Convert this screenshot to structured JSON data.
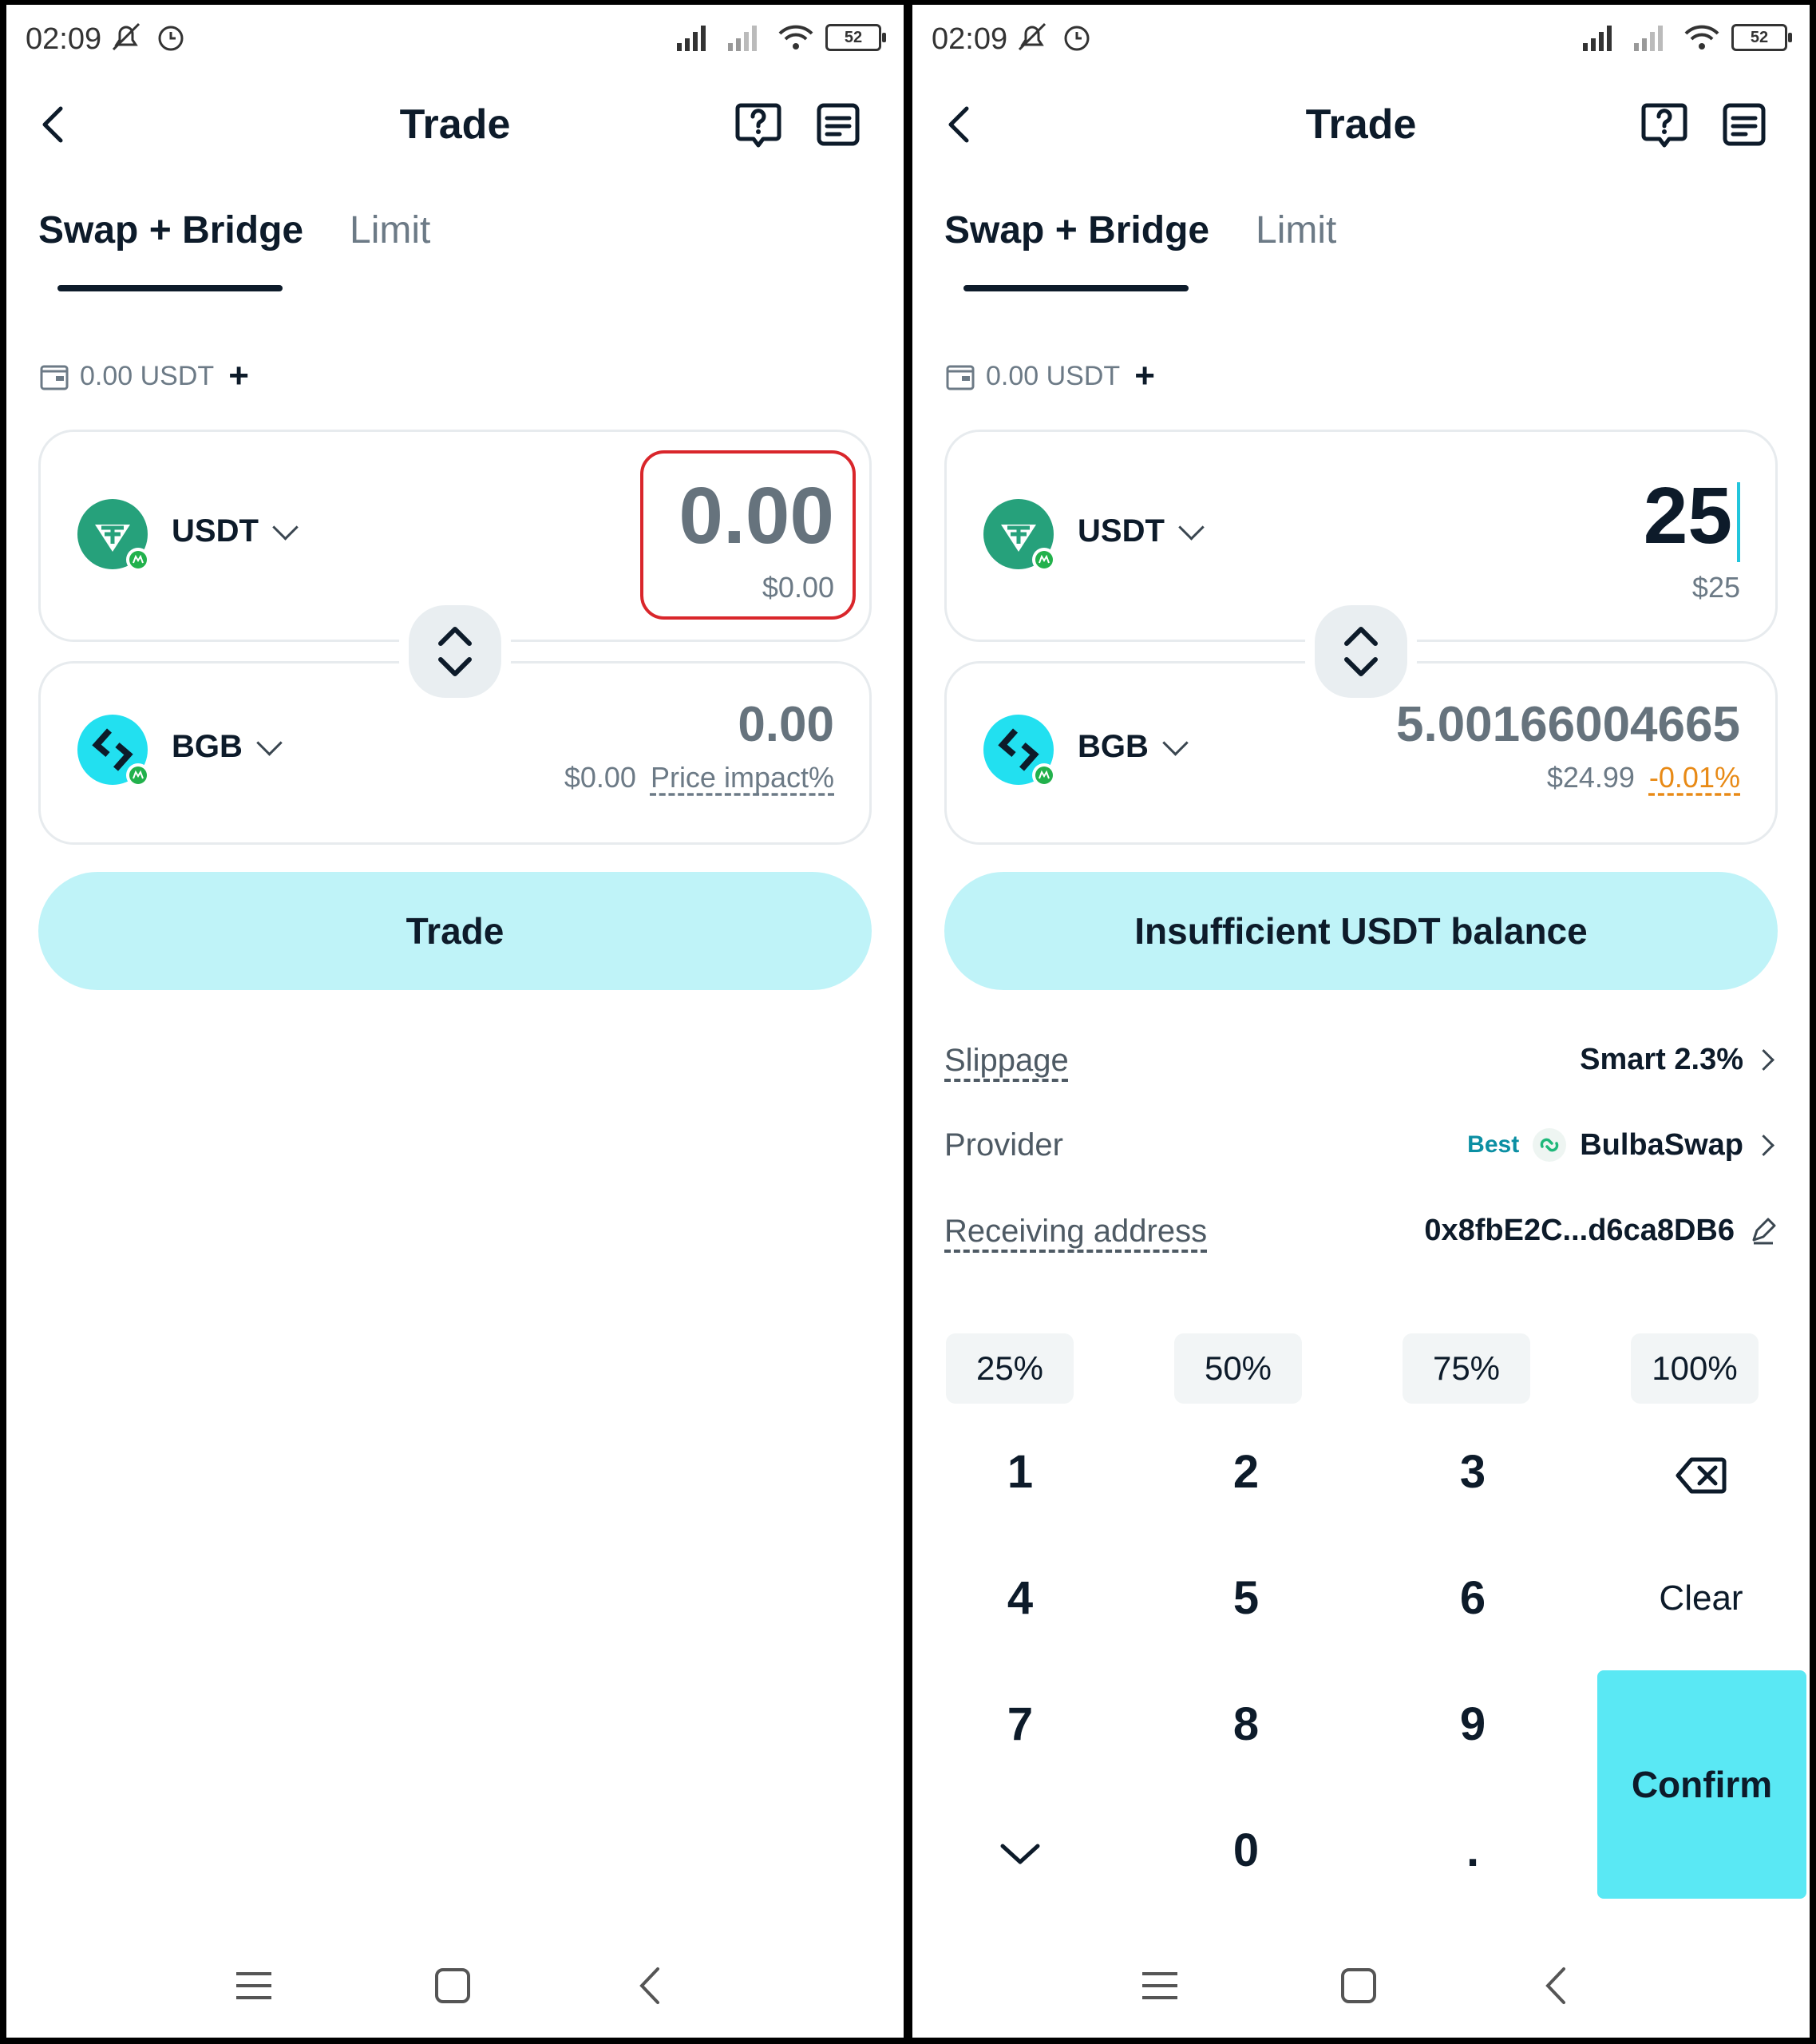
{
  "screens": {
    "left": {
      "status": {
        "time": "02:09",
        "battery": "52"
      },
      "header": {
        "title": "Trade"
      },
      "tabs": {
        "swap": "Swap + Bridge",
        "limit": "Limit"
      },
      "balance": "0.00 USDT",
      "from": {
        "token": "USDT",
        "amount": "0.00",
        "usd": "$0.00"
      },
      "to": {
        "token": "BGB",
        "amount": "0.00",
        "usd": "$0.00",
        "impact": "Price impact%"
      },
      "button": "Trade"
    },
    "right": {
      "status": {
        "time": "02:09",
        "battery": "52"
      },
      "header": {
        "title": "Trade"
      },
      "tabs": {
        "swap": "Swap + Bridge",
        "limit": "Limit"
      },
      "balance": "0.00 USDT",
      "from": {
        "token": "USDT",
        "amount": "25",
        "usd": "$25"
      },
      "to": {
        "token": "BGB",
        "amount": "5.00166004665",
        "usd": "$24.99",
        "impact": "-0.01%"
      },
      "button": "Insufficient USDT balance",
      "details": {
        "slippage_label": "Slippage",
        "slippage_value": "Smart 2.3%",
        "provider_label": "Provider",
        "provider_badge": "Best",
        "provider_value": "BulbaSwap",
        "address_label": "Receiving address",
        "address_value": "0x8fbE2C...d6ca8DB6"
      },
      "keypad": {
        "percentages": [
          "25%",
          "50%",
          "75%",
          "100%"
        ],
        "keys": [
          "1",
          "2",
          "3",
          "4",
          "5",
          "6",
          "7",
          "8",
          "9",
          ".",
          "0"
        ],
        "clear": "Clear",
        "confirm": "Confirm"
      }
    }
  },
  "colors": {
    "accent_button": "#bff3f8",
    "confirm_button": "#5ae8f4",
    "usdt": "#26a17b",
    "bgb": "#22d3ee",
    "highlight_box": "#d9262b",
    "negative_impact": "#e88a16"
  },
  "icons": [
    "back-arrow-icon",
    "help-icon",
    "history-icon",
    "wallet-icon",
    "plus-icon",
    "chevron-down-icon",
    "swap-direction-icon",
    "usdt-logo-icon",
    "bgb-logo-icon",
    "chain-badge-icon",
    "bulbaswap-logo-icon",
    "edit-icon",
    "backspace-icon",
    "collapse-keypad-icon",
    "nav-menu-icon",
    "nav-home-icon",
    "nav-back-icon"
  ]
}
